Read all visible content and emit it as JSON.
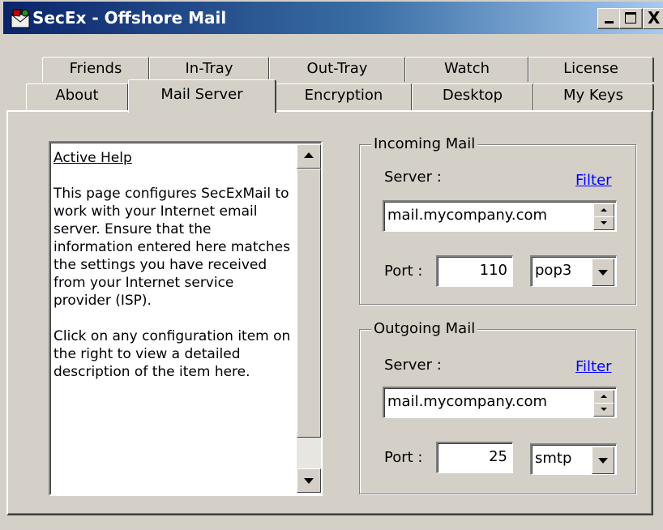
{
  "window": {
    "title": "SecEx - Offshore Mail",
    "icon": "secex-app-icon",
    "controls": {
      "minimize": "_",
      "maximize": "□",
      "close": "X"
    }
  },
  "tabs": {
    "row1": [
      {
        "label": "Friends"
      },
      {
        "label": "In-Tray"
      },
      {
        "label": "Out-Tray"
      },
      {
        "label": "Watch"
      },
      {
        "label": "License"
      }
    ],
    "row2": [
      {
        "label": "About"
      },
      {
        "label": "Mail Server",
        "active": true
      },
      {
        "label": "Encryption"
      },
      {
        "label": "Desktop"
      },
      {
        "label": "My Keys"
      }
    ]
  },
  "help": {
    "title": "Active Help",
    "text": "This page configures SecExMail to work with your Internet email server. Ensure that the information entered here matches the settings you have received from your Internet service provider (ISP).\n\nClick on any configuration item on the right to view a detailed description of the item here."
  },
  "incoming": {
    "legend": "Incoming Mail",
    "server_label": "Server :",
    "filter_label": "Filter",
    "server_value": "mail.mycompany.com",
    "port_label": "Port :",
    "port_value": "110",
    "protocol_value": "pop3"
  },
  "outgoing": {
    "legend": "Outgoing Mail",
    "server_label": "Server :",
    "filter_label": "Filter",
    "server_value": "mail.mycompany.com",
    "port_label": "Port :",
    "port_value": "25",
    "protocol_value": "smtp"
  },
  "colors": {
    "face": "#d4d0c8",
    "titlebar_start": "#0a246a",
    "titlebar_end": "#a6caf0",
    "link": "#0000ff"
  }
}
